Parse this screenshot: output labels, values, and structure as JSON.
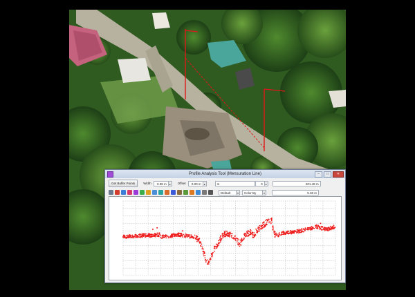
{
  "window": {
    "title": "Profile Analysis Tool (Mensuration Line)",
    "minimize_glyph": "–",
    "maximize_glyph": "□",
    "close_glyph": "✕"
  },
  "controls": {
    "get_buffer_points": "Get Buffer Points",
    "width_label": "Width",
    "width_value": "0.38 m",
    "offset_label": "Offset",
    "offset_value": "0.00 m",
    "field_a_label": "m",
    "field_a_value": "0",
    "distance_value": "201.48 m",
    "mode_select": "Default",
    "color_select": "Color By Model",
    "value2": "5.36 m"
  },
  "toolbar_icons": [
    "cursor-icon",
    "red-tool-icon",
    "measure-icon",
    "heart-icon",
    "color-wheel-icon",
    "house-icon",
    "zoom-icon",
    "mountain-icon",
    "wave-icon",
    "chart-icon",
    "blue-square-icon",
    "box-icon",
    "grid-icon",
    "orange-icon",
    "help-icon",
    "settings-icon",
    "gear-icon"
  ],
  "chart_data": {
    "type": "scatter",
    "color": "#ee1c1c",
    "grid": true,
    "x_divisions": 17,
    "y_divisions": 10,
    "xlim": [
      0,
      100
    ],
    "ylim": [
      0,
      100
    ],
    "profile": [
      [
        0,
        52
      ],
      [
        5,
        53
      ],
      [
        10,
        54
      ],
      [
        14,
        54
      ],
      [
        17,
        55
      ],
      [
        18,
        52
      ],
      [
        22,
        53
      ],
      [
        26,
        55
      ],
      [
        30,
        53
      ],
      [
        34,
        52
      ],
      [
        36,
        46
      ],
      [
        37,
        40
      ],
      [
        38,
        30
      ],
      [
        39,
        22
      ],
      [
        40,
        16
      ],
      [
        41,
        24
      ],
      [
        42,
        30
      ],
      [
        43,
        36
      ],
      [
        44,
        40
      ],
      [
        45,
        44
      ],
      [
        46,
        50
      ],
      [
        47,
        53
      ],
      [
        48,
        56
      ],
      [
        49,
        57
      ],
      [
        50,
        55
      ],
      [
        52,
        52
      ],
      [
        54,
        46
      ],
      [
        55,
        42
      ],
      [
        56,
        48
      ],
      [
        57,
        52
      ],
      [
        58,
        56
      ],
      [
        60,
        58
      ],
      [
        61,
        54
      ],
      [
        62,
        56
      ],
      [
        63,
        60
      ],
      [
        64,
        62
      ],
      [
        65,
        66
      ],
      [
        66,
        68
      ],
      [
        67,
        70
      ],
      [
        68,
        72
      ],
      [
        69,
        75
      ],
      [
        70,
        73
      ],
      [
        71,
        56
      ],
      [
        72,
        55
      ],
      [
        73,
        54
      ],
      [
        75,
        57
      ],
      [
        78,
        58
      ],
      [
        82,
        59
      ],
      [
        85,
        61
      ],
      [
        88,
        63
      ],
      [
        91,
        66
      ],
      [
        93,
        64
      ],
      [
        96,
        62
      ],
      [
        98,
        64
      ],
      [
        100,
        66
      ]
    ],
    "spikes": [
      [
        14,
        62
      ],
      [
        16,
        64
      ],
      [
        28,
        60
      ],
      [
        70,
        77
      ],
      [
        93,
        70
      ],
      [
        60,
        58
      ]
    ]
  }
}
